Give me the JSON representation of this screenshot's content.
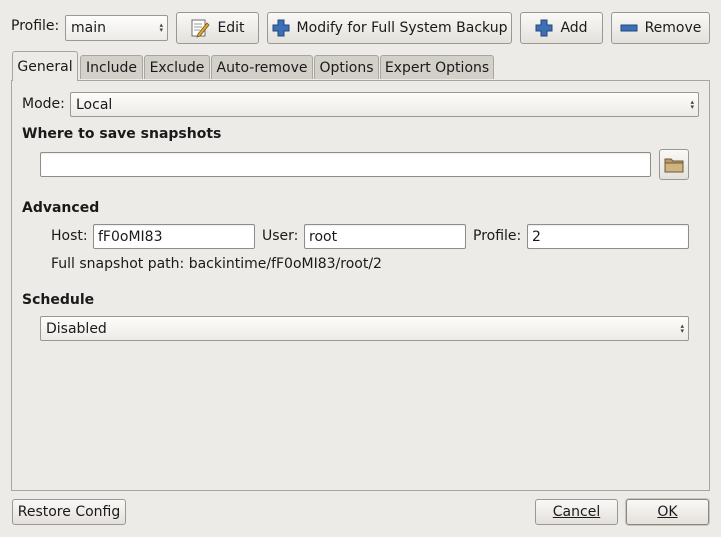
{
  "toolbar": {
    "profile_label": "Profile:",
    "profile_value": "main",
    "edit_label": "Edit",
    "modify_label": "Modify for Full System Backup",
    "add_label": "Add",
    "remove_label": "Remove"
  },
  "tabs": [
    {
      "label": "General",
      "active": true
    },
    {
      "label": "Include",
      "active": false
    },
    {
      "label": "Exclude",
      "active": false
    },
    {
      "label": "Auto-remove",
      "active": false
    },
    {
      "label": "Options",
      "active": false
    },
    {
      "label": "Expert Options",
      "active": false
    }
  ],
  "general": {
    "mode_label": "Mode:",
    "mode_value": "Local",
    "where_heading": "Where to save snapshots",
    "snapshot_path_value": "",
    "advanced_heading": "Advanced",
    "host_label": "Host:",
    "host_value": "fF0oMI83",
    "user_label": "User:",
    "user_value": "root",
    "profile_label": "Profile:",
    "profile_value": "2",
    "full_path_text": "Full snapshot path: backintime/fF0oMI83/root/2",
    "schedule_heading": "Schedule",
    "schedule_value": "Disabled"
  },
  "footer": {
    "restore_label": "Restore Config",
    "cancel_label": "Cancel",
    "ok_label": "OK"
  },
  "icons": {
    "edit": "edit-icon",
    "add": "plus-icon",
    "remove": "minus-icon",
    "folder": "folder-icon"
  },
  "colors": {
    "window_bg": "#edebe8",
    "plus_blue": "#3b6fb6"
  }
}
